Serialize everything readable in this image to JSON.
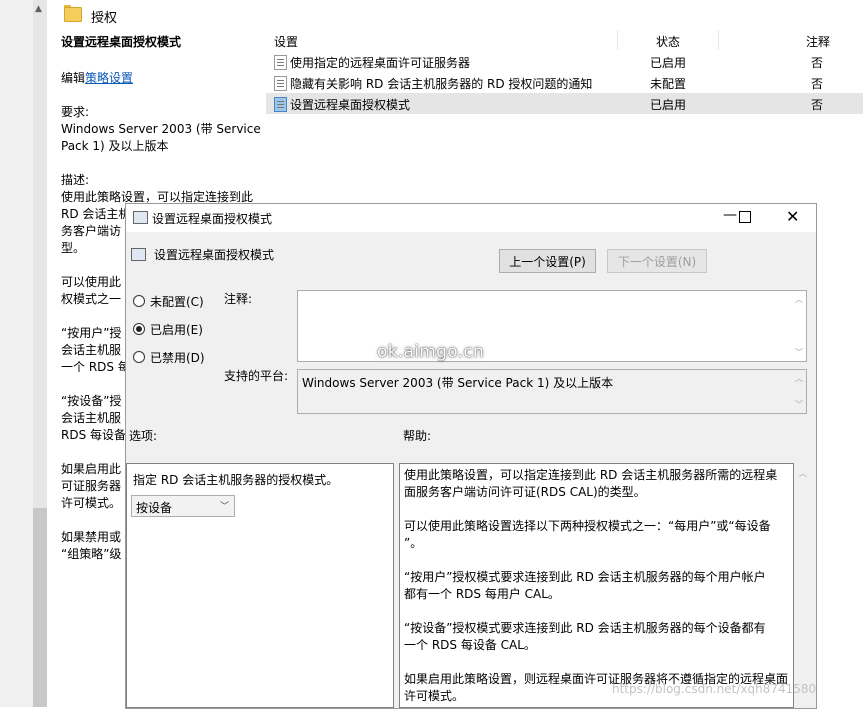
{
  "window": {
    "folder_title": "授权"
  },
  "description": {
    "title": "设置远程桌面授权模式",
    "edit_prefix": "编辑",
    "edit_link": "策略设置",
    "lines": [
      "要求:",
      "Windows Server 2003 (带 Service",
      "Pack 1) 及以上版本",
      "",
      "描述:",
      "使用此策略设置，可以指定连接到此",
      "RD 会话主机",
      "务客户端访",
      "型。",
      "",
      "可以使用此",
      "权模式之一",
      "",
      "“按用户”授",
      "会话主机服",
      "一个 RDS 每",
      "",
      "“按设备”授",
      "会话主机服",
      "RDS 每设备",
      "",
      "如果启用此",
      "可证服务器",
      "许可模式。",
      "",
      "如果禁用或",
      "“组策略”级"
    ]
  },
  "list": {
    "headers": {
      "setting": "设置",
      "state": "状态",
      "comment": "注释"
    },
    "rows": [
      {
        "name": "使用指定的远程桌面许可证服务器",
        "state": "已启用",
        "comment": "否",
        "icon": "policy-page-icon"
      },
      {
        "name": "隐藏有关影响 RD 会话主机服务器的 RD 授权问题的通知",
        "state": "未配置",
        "comment": "否",
        "icon": "policy-page-icon"
      },
      {
        "name": "设置远程桌面授权模式",
        "state": "已启用",
        "comment": "否",
        "icon": "policy-selected-icon"
      }
    ]
  },
  "dialog": {
    "title": "设置远程桌面授权模式",
    "header": "设置远程桌面授权模式",
    "prev_button": "上一个设置(P)",
    "next_button": "下一个设置(N)",
    "radios": [
      {
        "label": "未配置(C)",
        "checked": false
      },
      {
        "label": "已启用(E)",
        "checked": true
      },
      {
        "label": "已禁用(D)",
        "checked": false
      }
    ],
    "comment_label": "注释:",
    "platform_label": "支持的平台:",
    "platform_value": "Windows Server 2003 (带 Service Pack 1) 及以上版本",
    "options_label": "选项:",
    "help_label": "帮助:",
    "options_text": "指定 RD 会话主机服务器的授权模式。",
    "mode_select": "按设备",
    "help_lines": [
      "使用此策略设置，可以指定连接到此 RD 会话主机服务器所需的远程桌",
      "面服务客户端访问许可证(RDS CAL)的类型。",
      "",
      "可以使用此策略设置选择以下两种授权模式之一：“每用户”或“每设备",
      "”。",
      "",
      "“按用户”授权模式要求连接到此 RD 会话主机服务器的每个用户帐户",
      "都有一个 RDS 每用户 CAL。",
      "",
      "“按设备”授权模式要求连接到此 RD 会话主机服务器的每个设备都有",
      "一个 RDS 每设备 CAL。",
      "",
      "如果启用此策略设置，则远程桌面许可证服务器将不遵循指定的远程桌面",
      "许可模式。"
    ]
  },
  "watermarks": {
    "center": "ok.aimgo.cn",
    "bottom": "https://blog.csdn.net/xqh8741580"
  }
}
